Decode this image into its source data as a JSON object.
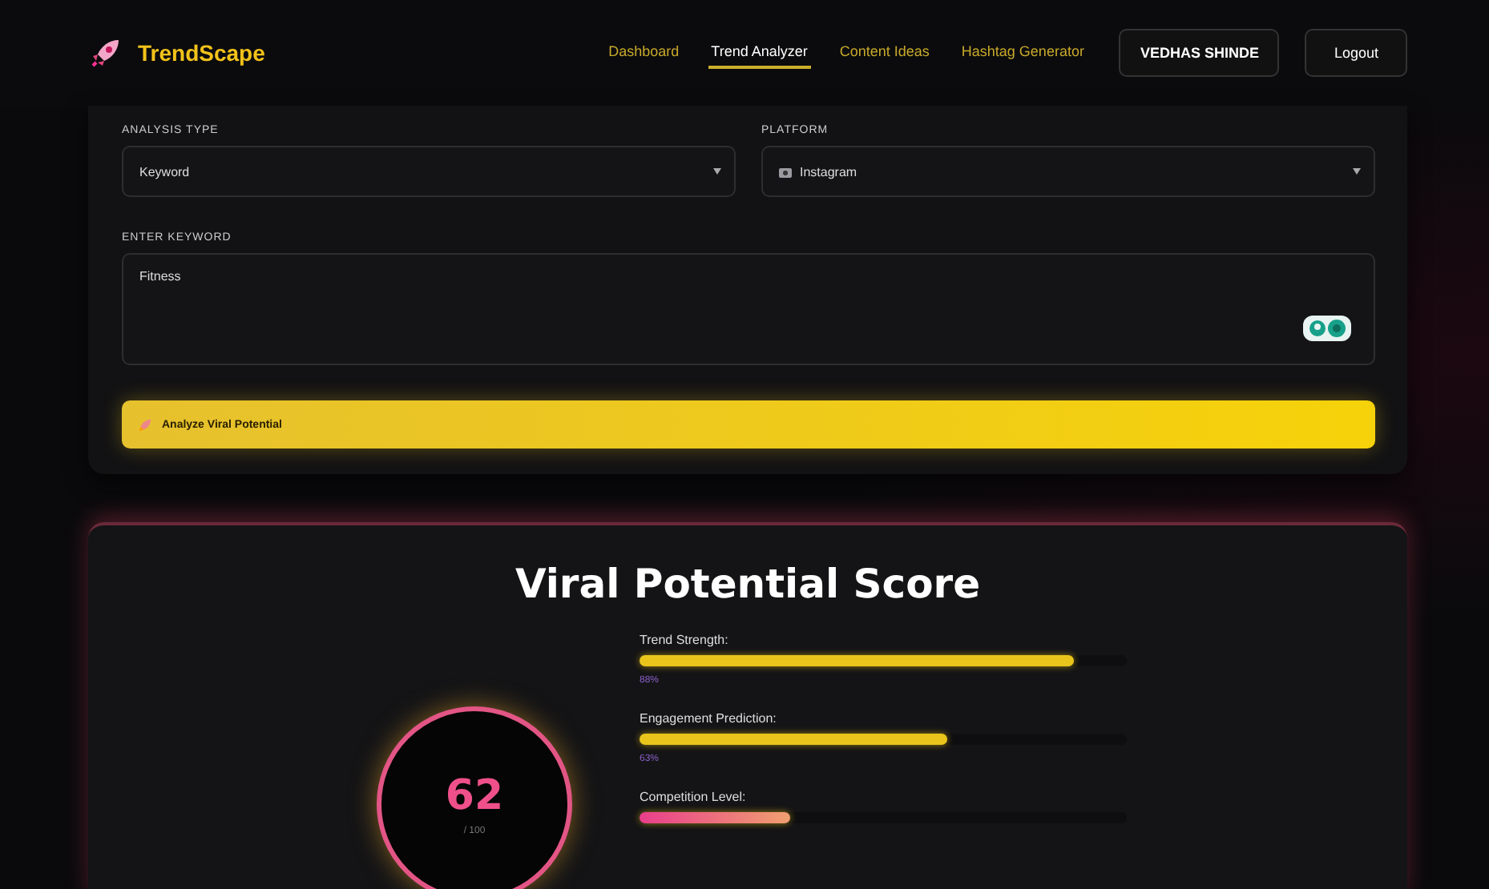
{
  "brand": "TrendScape",
  "nav": [
    {
      "label": "Dashboard",
      "selected": false
    },
    {
      "label": "Trend Analyzer",
      "selected": true
    },
    {
      "label": "Content Ideas",
      "selected": false
    },
    {
      "label": "Hashtag Generator",
      "selected": false
    }
  ],
  "user": "VEDHAS SHINDE",
  "logout": "Logout",
  "form": {
    "analysis_type": {
      "label": "ANALYSIS TYPE",
      "value": "Keyword"
    },
    "platform": {
      "label": "PLATFORM",
      "value": "Instagram"
    },
    "keyword": {
      "label": "ENTER KEYWORD",
      "value": "Fitness"
    },
    "submit": "Analyze Viral Potential"
  },
  "score": {
    "title": "Viral Potential Score",
    "value": "62",
    "max": "/ 100",
    "metrics": [
      {
        "label": "Trend Strength:",
        "level": 0.89,
        "reading": "88%"
      },
      {
        "label": "Engagement Prediction:",
        "level": 0.63,
        "reading": "63%"
      },
      {
        "label": "Competition Level:",
        "level": 0.31
      }
    ]
  }
}
